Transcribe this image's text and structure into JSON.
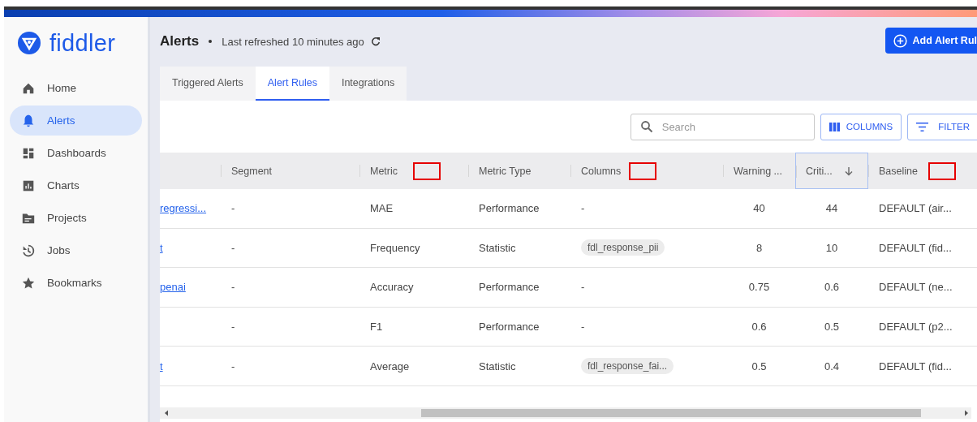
{
  "brand": {
    "name": "fiddler"
  },
  "sidebar": {
    "items": [
      {
        "label": "Home",
        "selected": false
      },
      {
        "label": "Alerts",
        "selected": true
      },
      {
        "label": "Dashboards",
        "selected": false
      },
      {
        "label": "Charts",
        "selected": false
      },
      {
        "label": "Projects",
        "selected": false
      },
      {
        "label": "Jobs",
        "selected": false
      },
      {
        "label": "Bookmarks",
        "selected": false
      }
    ]
  },
  "header": {
    "title": "Alerts",
    "refreshed": "Last refreshed 10 minutes ago",
    "add_button": "Add Alert Rul"
  },
  "tabs": [
    {
      "label": "Triggered Alerts",
      "selected": false
    },
    {
      "label": "Alert Rules",
      "selected": true
    },
    {
      "label": "Integrations",
      "selected": false
    }
  ],
  "toolbar": {
    "search": {
      "placeholder": "Search"
    },
    "columns_button": "COLUMNS",
    "filter_button": "FILTER"
  },
  "table": {
    "columns": [
      {
        "label": "Segment",
        "marked": false,
        "sorted": false
      },
      {
        "label": "Metric",
        "marked": true,
        "sorted": false
      },
      {
        "label": "Metric Type",
        "marked": false,
        "sorted": false
      },
      {
        "label": "Columns",
        "marked": true,
        "sorted": false
      },
      {
        "label": "Warning ...",
        "marked": false,
        "sorted": false
      },
      {
        "label": "Criti...",
        "marked": false,
        "sorted": true
      },
      {
        "label": "Baseline",
        "marked": true,
        "sorted": false
      }
    ],
    "rows": [
      {
        "name": "regressi...",
        "segment": "-",
        "metric": "MAE",
        "metric_type": "Performance",
        "columns": "-",
        "warning": "40",
        "critical": "44",
        "baseline": "DEFAULT (air..."
      },
      {
        "name": "t",
        "segment": "-",
        "metric": "Frequency",
        "metric_type": "Statistic",
        "columns": "fdl_response_pii",
        "warning": "8",
        "critical": "10",
        "baseline": "DEFAULT (fid..."
      },
      {
        "name": "penai",
        "segment": "-",
        "metric": "Accuracy",
        "metric_type": "Performance",
        "columns": "-",
        "warning": "0.75",
        "critical": "0.6",
        "baseline": "DEFAULT (ne..."
      },
      {
        "segment": "-",
        "metric": "F1",
        "metric_type": "Performance",
        "columns": "-",
        "warning": "0.6",
        "critical": "0.5",
        "baseline": "DEFAULT (p2..."
      },
      {
        "name": "t",
        "segment": "-",
        "metric": "Average",
        "metric_type": "Statistic",
        "columns": "fdl_response_fai...",
        "warning": "0.5",
        "critical": "0.4",
        "baseline": "DEFAULT (fid..."
      }
    ]
  }
}
